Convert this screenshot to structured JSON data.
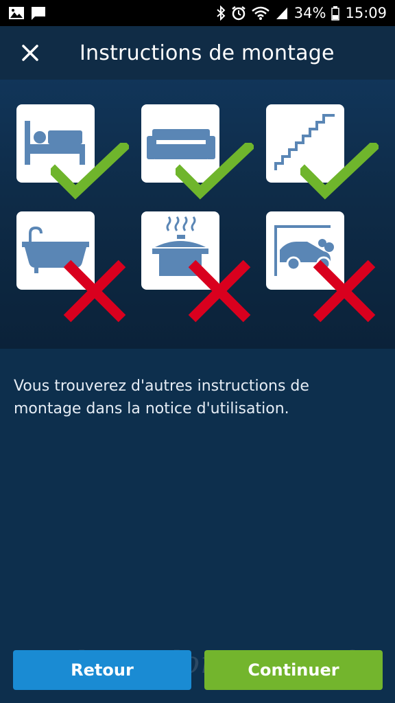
{
  "status_bar": {
    "battery": "34%",
    "time": "15:09"
  },
  "header": {
    "title": "Instructions de montage"
  },
  "illustration": {
    "items": [
      {
        "icon": "bed-icon",
        "allowed": true
      },
      {
        "icon": "sofa-icon",
        "allowed": true
      },
      {
        "icon": "stairs-icon",
        "allowed": true
      },
      {
        "icon": "bathtub-icon",
        "allowed": false
      },
      {
        "icon": "cooking-pot-icon",
        "allowed": false
      },
      {
        "icon": "garage-car-icon",
        "allowed": false
      }
    ],
    "colors": {
      "check": "#6fb52c",
      "cross": "#d9001e",
      "icon": "#5a86b5"
    }
  },
  "main": {
    "text": "Vous trouverez d'autres instructions de montage dans la notice d'utilisation."
  },
  "footer": {
    "back_label": "Retour",
    "next_label": "Continuer"
  },
  "watermark": "Habitat-domotique.fr"
}
